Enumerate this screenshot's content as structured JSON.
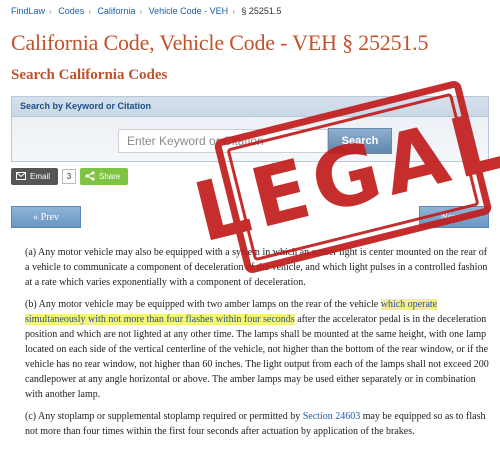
{
  "breadcrumb": {
    "items": [
      "FindLaw",
      "Codes",
      "California",
      "Vehicle Code - VEH",
      "§ 25251.5"
    ]
  },
  "page": {
    "title": "California Code, Vehicle Code - VEH § 25251.5"
  },
  "search": {
    "heading": "Search California Codes",
    "panel_label": "Search by Keyword or Citation",
    "placeholder": "Enter Keyword or Citation",
    "button_label": "Search"
  },
  "share": {
    "email_label": "Email",
    "email_count": "3",
    "share_label": "Share"
  },
  "nav": {
    "prev_label": "« Prev",
    "next_label": "Next »"
  },
  "stamp": {
    "text": "LEGAL"
  },
  "content": {
    "p1": "(a)  Any motor vehicle may also be equipped with a system in which an amber light is center mounted on the rear of a vehicle to communicate a component of deceleration of the vehicle, and which light pulses in a controlled fashion at a rate which varies exponentially with a component of deceleration.",
    "p2_before": "(b)  Any motor vehicle may be equipped with two amber lamps on the rear of the vehicle ",
    "p2_highlight": "which operate simultaneously with not more than four flashes within four seconds",
    "p2_after": " after the accelerator pedal is in the deceleration position and which are not lighted at any other time.   The lamps shall be mounted at the same height, with one lamp located on each side of the vertical centerline of the vehicle, not higher than the bottom of the rear window, or if the vehicle has no rear window, not higher than 60 inches.   The light output from each of the lamps shall not exceed 200 candlepower at any angle horizontal or above.   The amber lamps may be used either separately or in combination with another lamp.",
    "p3_before": "(c)  Any stoplamp or supplemental stoplamp required or permitted by ",
    "p3_link": "Section 24603",
    "p3_after": " may be equipped so as to flash not more than four times within the first four seconds after actuation by application of the brakes."
  },
  "colors": {
    "title": "#c0532b",
    "link": "#1a5ea8",
    "stamp": "#c21d1d",
    "highlight": "#f6f27f",
    "share_green": "#7ec342"
  }
}
